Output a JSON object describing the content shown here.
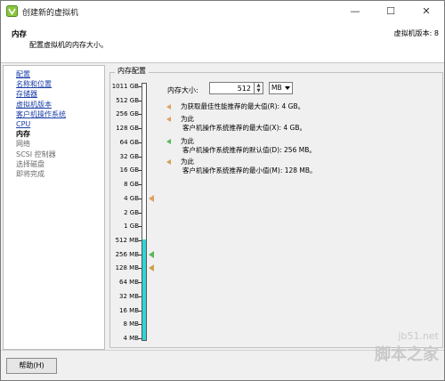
{
  "window": {
    "title": "创建新的虚拟机",
    "controls": {
      "minimize": "—",
      "maximize": "☐",
      "close": "✕"
    }
  },
  "header": {
    "title": "内存",
    "subtitle": "配置虚拟机的内存大小。",
    "version": "虚拟机版本: 8"
  },
  "sidebar": {
    "items": [
      {
        "label": "配置",
        "state": "link"
      },
      {
        "label": "名称和位置",
        "state": "link"
      },
      {
        "label": "存储器",
        "state": "link"
      },
      {
        "label": "虚拟机版本",
        "state": "link"
      },
      {
        "label": "客户机操作系统",
        "state": "link"
      },
      {
        "label": "CPU",
        "state": "link"
      },
      {
        "label": "内存",
        "state": "current"
      },
      {
        "label": "网络",
        "state": "disabled"
      },
      {
        "label": "SCSI 控制器",
        "state": "disabled"
      },
      {
        "label": "选择磁盘",
        "state": "disabled"
      },
      {
        "label": "即将完成",
        "state": "disabled"
      }
    ]
  },
  "memory_config": {
    "group_label": "内存配置",
    "size_label": "内存大小:",
    "size_value": "512",
    "unit": "MB",
    "scale_labels": [
      "1011 GB",
      "512 GB",
      "256 GB",
      "128 GB",
      "64 GB",
      "32 GB",
      "16 GB",
      "8 GB",
      "4 GB",
      "2 GB",
      "1 GB",
      "512 MB",
      "256 MB",
      "128 MB",
      "64 MB",
      "32 MB",
      "16 MB",
      "8 MB",
      "4 MB"
    ],
    "selected_index": 11,
    "markers": [
      {
        "index": 8,
        "kind": "max-performance",
        "color": "#e0a060"
      },
      {
        "index": 12,
        "kind": "default",
        "color": "#58b858"
      },
      {
        "index": 13,
        "kind": "min",
        "color": "#d0a050"
      }
    ],
    "legend": [
      {
        "line1": "为获取最佳性能推荐的最大值(R): 4 GB。",
        "line2": "",
        "color": "#e0a060"
      },
      {
        "line1": "为此",
        "line2": "客户机操作系统推荐的最大值(X): 4 GB。",
        "color": "#e0a060"
      },
      {
        "line1": "为此",
        "line2": "客户机操作系统推荐的默认值(D): 256 MB。",
        "color": "#58b858"
      },
      {
        "line1": "为此",
        "line2": "客户机操作系统推荐的最小值(M): 128 MB。",
        "color": "#d0a050"
      }
    ]
  },
  "footer": {
    "help_label": "帮助(H)"
  },
  "watermark": {
    "url": "jb51.net",
    "name": "脚本之家"
  }
}
